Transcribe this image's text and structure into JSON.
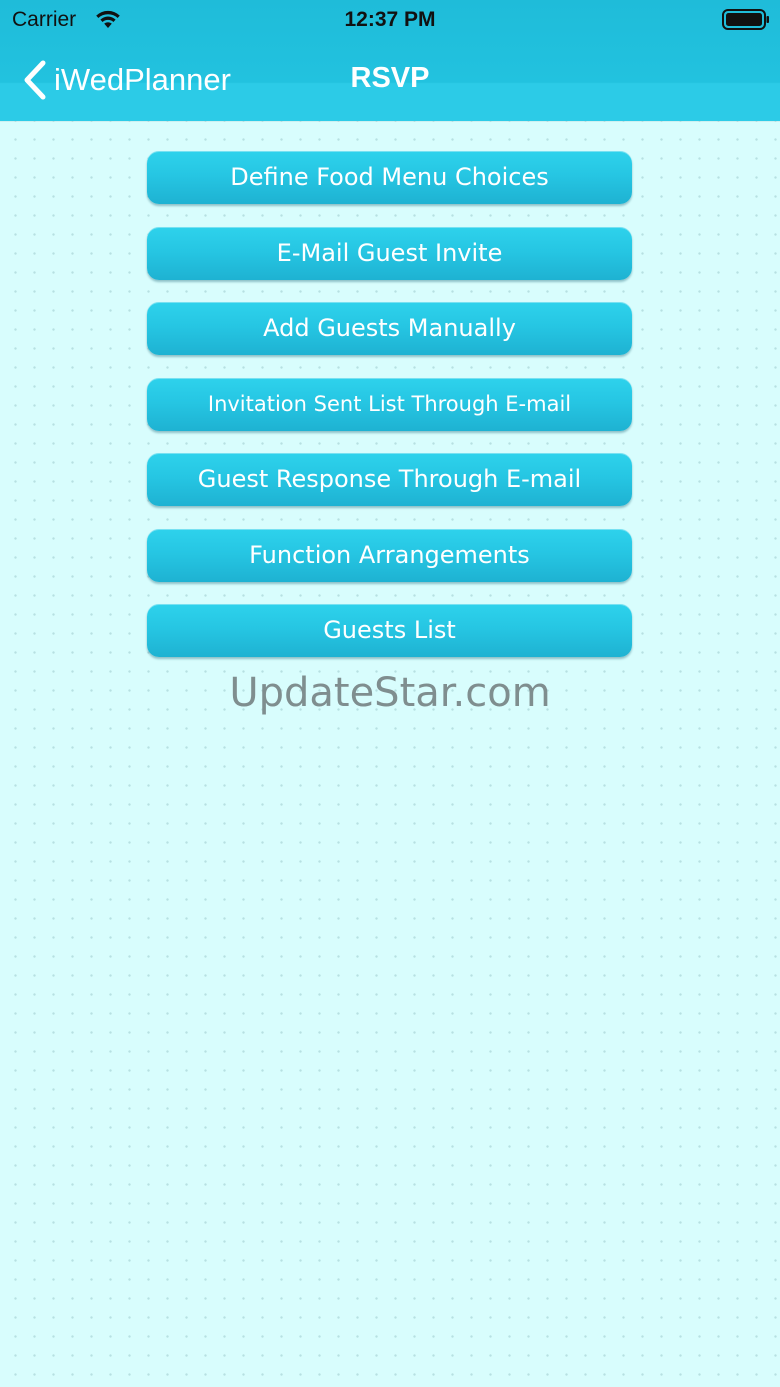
{
  "status_bar": {
    "carrier": "Carrier",
    "time": "12:37 PM",
    "wifi_icon": "wifi-icon",
    "battery_icon": "battery-icon"
  },
  "nav_bar": {
    "back_label": "iWedPlanner",
    "back_icon": "chevron-left-icon",
    "title": "RSVP"
  },
  "menu": {
    "items": [
      {
        "label": "Define Food Menu Choices"
      },
      {
        "label": "E-Mail Guest Invite"
      },
      {
        "label": "Add Guests Manually"
      },
      {
        "label": "Invitation Sent List Through E-mail"
      },
      {
        "label": "Guest Response Through E-mail"
      },
      {
        "label": "Function Arrangements"
      },
      {
        "label": "Guests List"
      }
    ]
  },
  "watermark": "UpdateStar.com",
  "colors": {
    "header": "#22c2df",
    "button": "#26c6e3",
    "background": "#d8fdfd",
    "button_text": "#ffffff"
  }
}
